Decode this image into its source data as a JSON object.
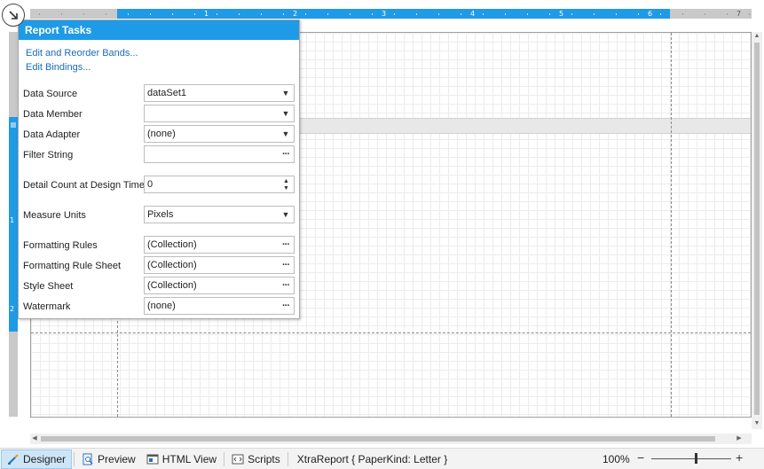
{
  "panel": {
    "title": "Report Tasks",
    "links": [
      "Edit and Reorder Bands...",
      "Edit Bindings..."
    ],
    "rows": {
      "data_source": {
        "label": "Data Source",
        "value": "dataSet1"
      },
      "data_member": {
        "label": "Data Member",
        "value": ""
      },
      "data_adapter": {
        "label": "Data Adapter",
        "value": "(none)"
      },
      "filter_string": {
        "label": "Filter String",
        "value": ""
      },
      "detail_count": {
        "label": "Detail Count at Design Time",
        "value": "0"
      },
      "measure_units": {
        "label": "Measure Units",
        "value": "Pixels"
      },
      "formatting_rules": {
        "label": "Formatting Rules",
        "value": "(Collection)"
      },
      "formatting_rule_sheet": {
        "label": "Formatting Rule Sheet",
        "value": "(Collection)"
      },
      "style_sheet": {
        "label": "Style Sheet",
        "value": "(Collection)"
      },
      "watermark": {
        "label": "Watermark",
        "value": "(none)"
      }
    }
  },
  "ruler": {
    "h_labels": [
      "1",
      "2",
      "3",
      "4",
      "5",
      "6",
      "7"
    ],
    "v_labels": [
      "1",
      "2"
    ]
  },
  "statusbar": {
    "designer": "Designer",
    "preview": "Preview",
    "html_view": "HTML View",
    "scripts": "Scripts",
    "report_info": "XtraReport { PaperKind: Letter }",
    "zoom": "100%",
    "zoom_minus": "−",
    "zoom_plus": "+"
  },
  "colors": {
    "accent": "#1f9ae6",
    "link": "#1a6bb5",
    "active_tab": "#cde6f7"
  }
}
